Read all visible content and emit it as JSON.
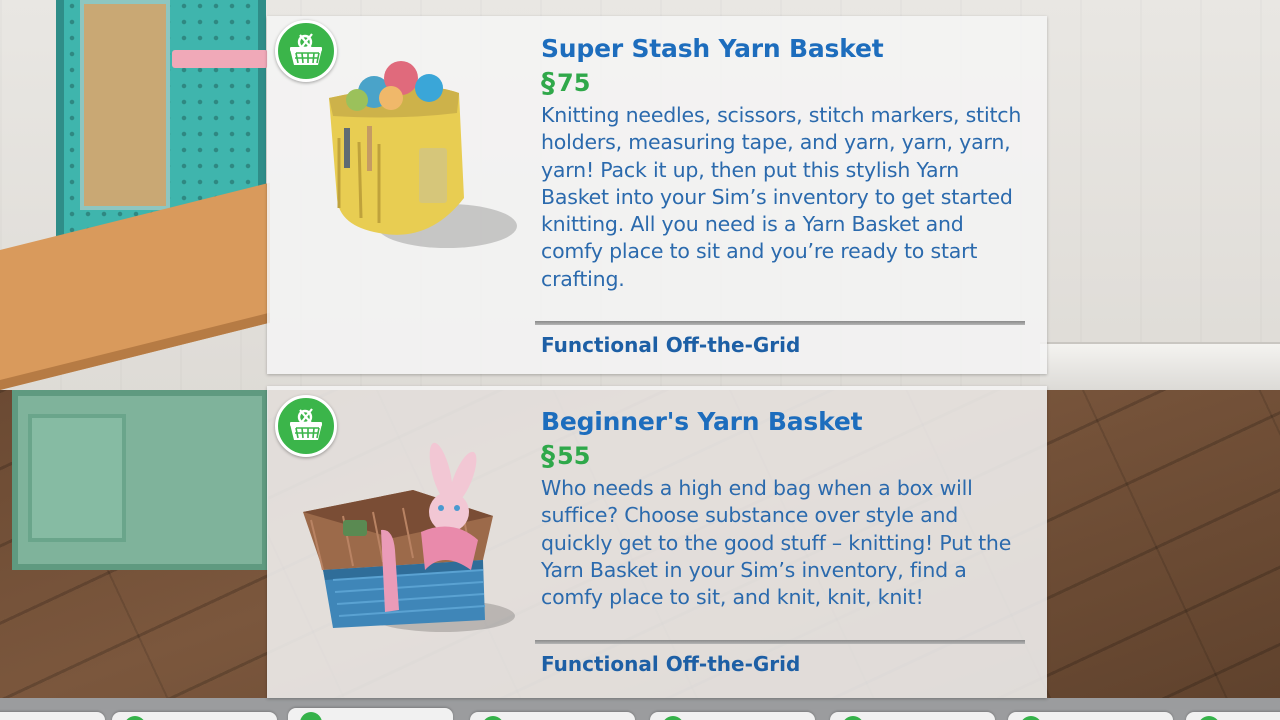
{
  "catalog": {
    "items": [
      {
        "title": "Super Stash Yarn Basket",
        "currency_symbol": "§",
        "price": "75",
        "description": "Knitting needles, scissors, stitch markers, stitch holders, measuring tape, and yarn, yarn, yarn, yarn! Pack it up, then put this stylish Yarn Basket into your Sim’s inventory to get started knitting. All you need is a Yarn Basket and comfy place to sit and you’re ready to start crafting.",
        "tag": "Functional Off-the-Grid",
        "badge_icon": "knitting-basket-icon",
        "image": "yellow-yarn-bag-image"
      },
      {
        "title": "Beginner's Yarn Basket",
        "currency_symbol": "§",
        "price": "55",
        "description": "Who needs a high end bag when a box will suffice? Choose substance over style and quickly get to the good stuff – knitting! Put the Yarn Basket in your Sim’s inventory, find a comfy place to sit, and knit, knit, knit!",
        "tag": "Functional Off-the-Grid",
        "badge_icon": "knitting-basket-icon",
        "image": "wicker-box-basket-image"
      }
    ]
  },
  "colors": {
    "title": "#1d6dbd",
    "price": "#2fa84a",
    "description": "#2b6aad",
    "badge": "#3bb54a"
  }
}
